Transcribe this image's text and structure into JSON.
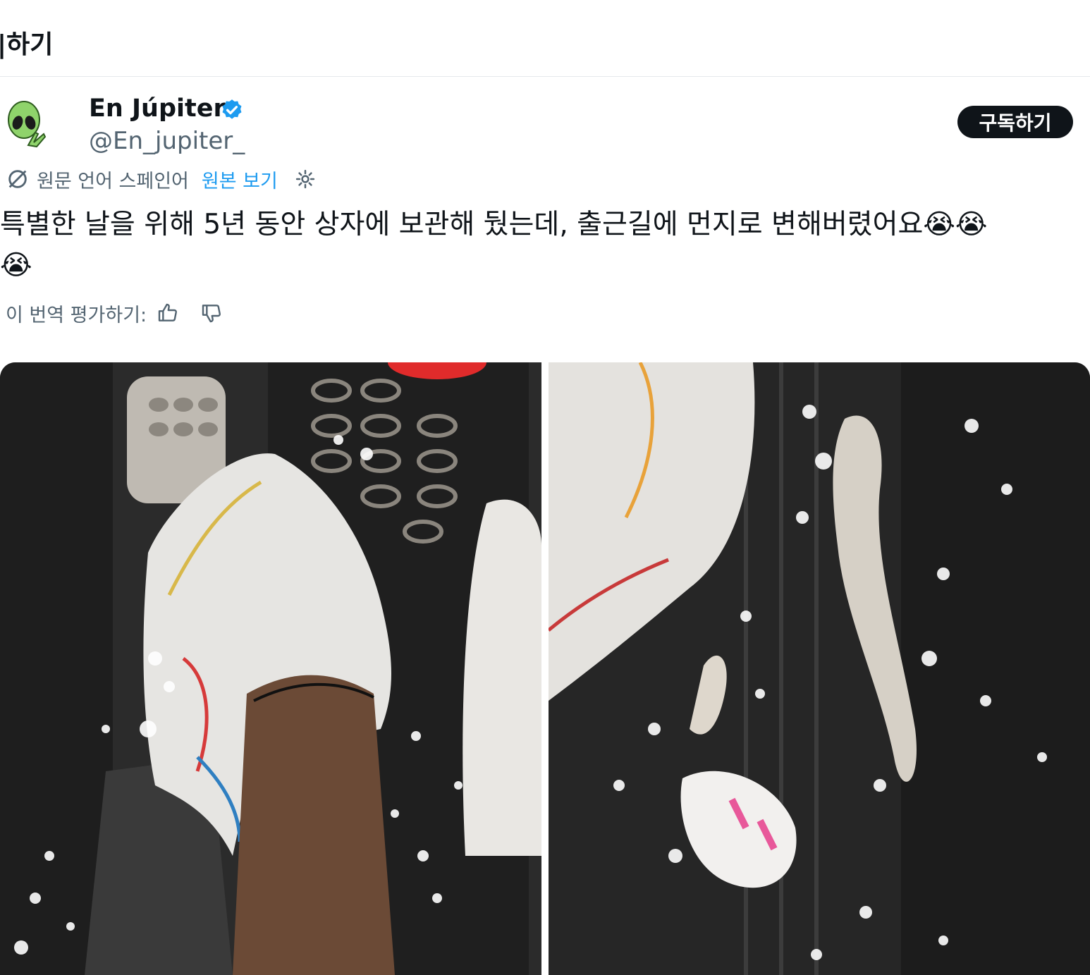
{
  "header": {
    "title": "|하기"
  },
  "tweet": {
    "author_name": "En Júpiter",
    "author_handle": "@En_jupiter_",
    "subscribe_label": "구독하기",
    "translation": {
      "source_language": "원문 언어 스페인어",
      "show_original": "원본 보기"
    },
    "text_line1": "특별한 날을 위해 5년 동안 상자에 보관해 뒀는데, 출근길에 먼지로 변해버렸어요😭😭",
    "text_line2": "😭",
    "rate_label": "이 번역 평가하기:",
    "images": [
      {
        "icon": "photo-sneaker-on-pedal"
      },
      {
        "icon": "photo-crumbled-sole"
      }
    ]
  },
  "colors": {
    "accent": "#1d9bf0",
    "text": "#0f1419",
    "muted": "#536471",
    "button_bg": "#0f1419"
  }
}
